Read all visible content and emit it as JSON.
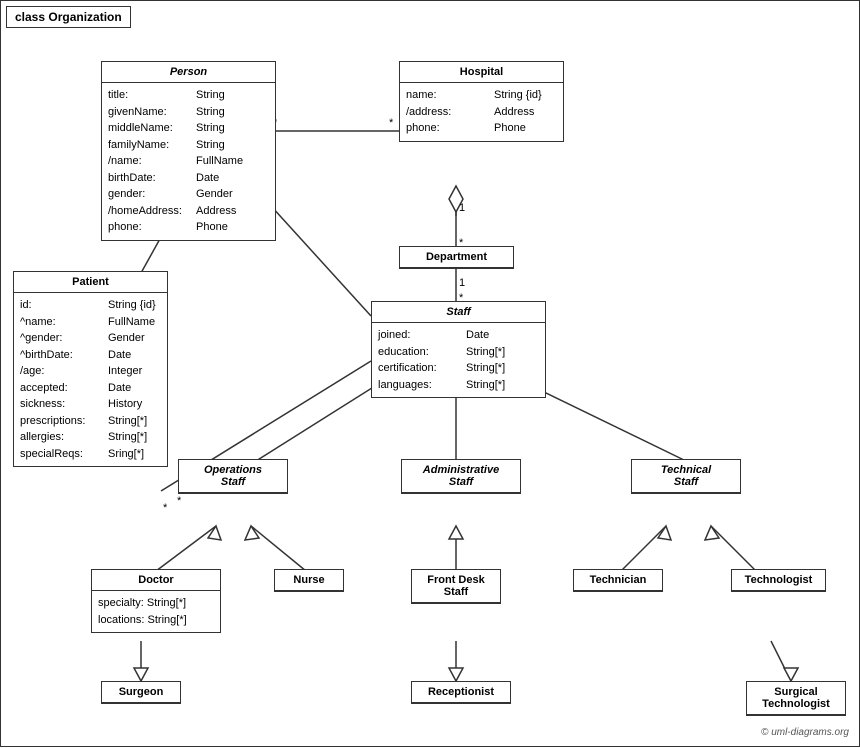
{
  "title": "class Organization",
  "classes": {
    "person": {
      "name": "Person",
      "italic": true,
      "attrs": [
        {
          "name": "title:",
          "type": "String"
        },
        {
          "name": "givenName:",
          "type": "String"
        },
        {
          "name": "middleName:",
          "type": "String"
        },
        {
          "name": "familyName:",
          "type": "String"
        },
        {
          "name": "/name:",
          "type": "FullName"
        },
        {
          "name": "birthDate:",
          "type": "Date"
        },
        {
          "name": "gender:",
          "type": "Gender"
        },
        {
          "name": "/homeAddress:",
          "type": "Address"
        },
        {
          "name": "phone:",
          "type": "Phone"
        }
      ]
    },
    "hospital": {
      "name": "Hospital",
      "italic": false,
      "attrs": [
        {
          "name": "name:",
          "type": "String {id}"
        },
        {
          "name": "/address:",
          "type": "Address"
        },
        {
          "name": "phone:",
          "type": "Phone"
        }
      ]
    },
    "department": {
      "name": "Department",
      "italic": false,
      "attrs": []
    },
    "staff": {
      "name": "Staff",
      "italic": true,
      "attrs": [
        {
          "name": "joined:",
          "type": "Date"
        },
        {
          "name": "education:",
          "type": "String[*]"
        },
        {
          "name": "certification:",
          "type": "String[*]"
        },
        {
          "name": "languages:",
          "type": "String[*]"
        }
      ]
    },
    "patient": {
      "name": "Patient",
      "italic": false,
      "attrs": [
        {
          "name": "id:",
          "type": "String {id}"
        },
        {
          "name": "^name:",
          "type": "FullName"
        },
        {
          "name": "^gender:",
          "type": "Gender"
        },
        {
          "name": "^birthDate:",
          "type": "Date"
        },
        {
          "name": "/age:",
          "type": "Integer"
        },
        {
          "name": "accepted:",
          "type": "Date"
        },
        {
          "name": "sickness:",
          "type": "History"
        },
        {
          "name": "prescriptions:",
          "type": "String[*]"
        },
        {
          "name": "allergies:",
          "type": "String[*]"
        },
        {
          "name": "specialReqs:",
          "type": "Sring[*]"
        }
      ]
    },
    "operations_staff": {
      "name": "Operations\nStaff",
      "italic": true,
      "attrs": []
    },
    "administrative_staff": {
      "name": "Administrative\nStaff",
      "italic": true,
      "attrs": []
    },
    "technical_staff": {
      "name": "Technical\nStaff",
      "italic": true,
      "attrs": []
    },
    "doctor": {
      "name": "Doctor",
      "italic": false,
      "attrs": [
        {
          "name": "specialty:",
          "type": "String[*]"
        },
        {
          "name": "locations:",
          "type": "String[*]"
        }
      ]
    },
    "nurse": {
      "name": "Nurse",
      "italic": false,
      "attrs": []
    },
    "front_desk_staff": {
      "name": "Front Desk\nStaff",
      "italic": false,
      "attrs": []
    },
    "technician": {
      "name": "Technician",
      "italic": false,
      "attrs": []
    },
    "technologist": {
      "name": "Technologist",
      "italic": false,
      "attrs": []
    },
    "surgeon": {
      "name": "Surgeon",
      "italic": false,
      "attrs": []
    },
    "receptionist": {
      "name": "Receptionist",
      "italic": false,
      "attrs": []
    },
    "surgical_technologist": {
      "name": "Surgical\nTechnologist",
      "italic": false,
      "attrs": []
    }
  },
  "copyright": "© uml-diagrams.org"
}
